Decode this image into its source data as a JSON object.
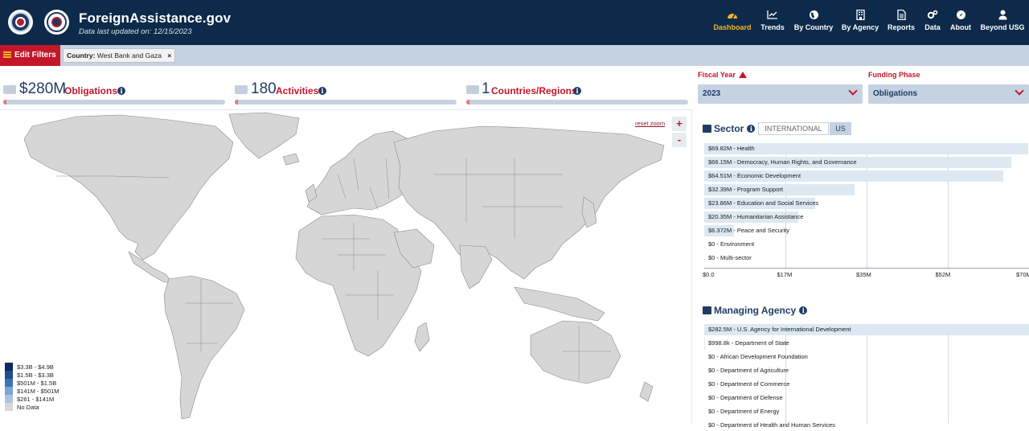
{
  "header": {
    "site_title": "ForeignAssistance.gov",
    "last_updated": "Data last updated on: 12/15/2023",
    "nav": [
      {
        "label": "Dashboard",
        "icon": "dashboard-gauge-icon",
        "active": true
      },
      {
        "label": "Trends",
        "icon": "trend-chart-icon"
      },
      {
        "label": "By Country",
        "icon": "globe-icon"
      },
      {
        "label": "By Agency",
        "icon": "building-icon"
      },
      {
        "label": "Reports",
        "icon": "document-icon"
      },
      {
        "label": "Data",
        "icon": "gears-icon"
      },
      {
        "label": "About",
        "icon": "compass-icon"
      },
      {
        "label": "Beyond USG",
        "icon": "person-icon"
      }
    ]
  },
  "filters": {
    "edit_label": "Edit Filters",
    "chip_key": "Country:",
    "chip_value": "West Bank and Gaza",
    "chip_remove": "×"
  },
  "stats": {
    "obligations_value": "$280M",
    "obligations_label": "Obligations",
    "activities_value": "180",
    "activities_label": "Activities",
    "countries_value": "1",
    "countries_label": "Countries/Regions"
  },
  "selectors": {
    "fiscal_year_label": "Fiscal Year",
    "fiscal_year_value": "2023",
    "funding_phase_label": "Funding Phase",
    "funding_phase_value": "Obligations"
  },
  "map": {
    "reset_zoom": "reset zoom",
    "zoom_in": "+",
    "zoom_out": "-",
    "legend": [
      {
        "label": "$3.3B - $4.9B",
        "color": "#0c2b5c"
      },
      {
        "label": "$1.5B - $3.3B",
        "color": "#1e4f8c"
      },
      {
        "label": "$501M - $1.5B",
        "color": "#3b74b8"
      },
      {
        "label": "$141M - $501M",
        "color": "#7aa5d4"
      },
      {
        "label": "$261 - $141M",
        "color": "#a9c4e2"
      },
      {
        "label": "No Data",
        "color": "#d6d6d6"
      }
    ]
  },
  "sector": {
    "title": "Sector",
    "toggle_international": "INTERNATIONAL",
    "toggle_us": "US",
    "bars": [
      {
        "label": "$69.82M - Health",
        "value": 69.82
      },
      {
        "label": "$66.15M - Democracy, Human Rights, and Governance",
        "value": 66.15
      },
      {
        "label": "$64.51M - Economic Development",
        "value": 64.51
      },
      {
        "label": "$32.39M - Program Support",
        "value": 32.39
      },
      {
        "label": "$23.86M - Education and Social Services",
        "value": 23.86
      },
      {
        "label": "$20.35M - Humanitarian Assistance",
        "value": 20.35
      },
      {
        "label": "$6.372M - Peace and Security",
        "value": 6.372
      },
      {
        "label": "$0 - Environment",
        "value": 0
      },
      {
        "label": "$0 - Multi-sector",
        "value": 0
      }
    ],
    "axis": [
      "$0.0",
      "$17M",
      "$35M",
      "$52M",
      "$70M"
    ],
    "axis_max": 70
  },
  "agency": {
    "title": "Managing Agency",
    "bars": [
      {
        "label": "$282.5M - U.S. Agency for International Development",
        "value": 282.5
      },
      {
        "label": "$998.8k - Department of State",
        "value": 0.9988
      },
      {
        "label": "$0 - African Development Foundation",
        "value": 0
      },
      {
        "label": "$0 - Department of Agriculture",
        "value": 0
      },
      {
        "label": "$0 - Department of Commerce",
        "value": 0
      },
      {
        "label": "$0 - Department of Defense",
        "value": 0
      },
      {
        "label": "$0 - Department of Energy",
        "value": 0
      },
      {
        "label": "$0 - Department of Health and Human Services",
        "value": 0
      }
    ],
    "axis_max": 282.5
  }
}
